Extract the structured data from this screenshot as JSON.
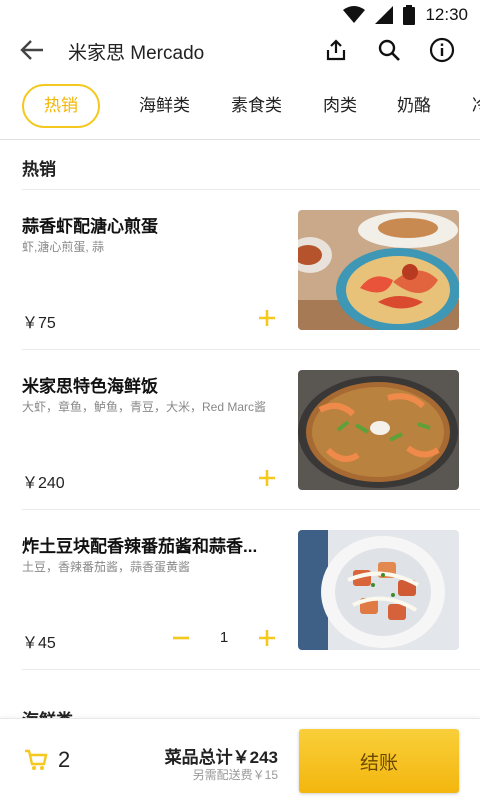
{
  "status_bar": {
    "time": "12:30"
  },
  "header": {
    "title": "米家思 Mercado"
  },
  "categories": [
    {
      "label": "热销"
    },
    {
      "label": "海鲜类"
    },
    {
      "label": "素食类"
    },
    {
      "label": "肉类"
    },
    {
      "label": "奶酪"
    },
    {
      "label": "冷"
    }
  ],
  "sections": [
    {
      "title": "热销"
    },
    {
      "title": "海鲜类"
    }
  ],
  "items": [
    {
      "name": "蒜香虾配溏心煎蛋",
      "desc": "虾,溏心煎蛋, 蒜",
      "price": "￥75"
    },
    {
      "name": "米家思特色海鲜饭",
      "desc": "大虾，章鱼，鲈鱼，青豆，大米，Red Marc酱",
      "price": "￥240"
    },
    {
      "name": "炸土豆块配香辣番茄酱和蒜香...",
      "desc": "土豆，香辣番茄酱，蒜香蛋黄酱",
      "price": "￥45",
      "qty": "1"
    }
  ],
  "bottom_bar": {
    "cart_count": "2",
    "total_label": "菜品总计￥243",
    "delivery_fee": "另需配送费￥15",
    "checkout_label": "结账"
  },
  "colors": {
    "accent": "#f4c81c",
    "accent_text": "#f2b705"
  }
}
